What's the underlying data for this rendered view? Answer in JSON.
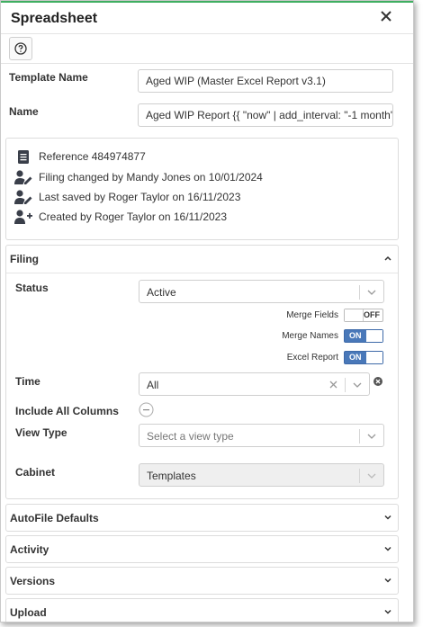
{
  "header": {
    "title": "Spreadsheet"
  },
  "form": {
    "template_name_label": "Template Name",
    "template_name_value": "Aged WIP (Master Excel Report v3.1)",
    "name_label": "Name",
    "name_value": "Aged WIP Report {{ \"now\" | add_interval: \"-1 month\"..."
  },
  "info": {
    "reference": "Reference 484974877",
    "filing_changed": "Filing changed by Mandy Jones on 10/01/2024",
    "last_saved": "Last saved by Roger Taylor on 16/11/2023",
    "created": "Created by Roger Taylor on 16/11/2023"
  },
  "filing": {
    "title": "Filing",
    "status_label": "Status",
    "status_value": "Active",
    "merge_fields_label": "Merge Fields",
    "merge_fields_state": "OFF",
    "merge_names_label": "Merge Names",
    "merge_names_state": "ON",
    "excel_report_label": "Excel Report",
    "excel_report_state": "ON",
    "time_label": "Time",
    "time_value": "All",
    "include_all_columns_label": "Include All Columns",
    "view_type_label": "View Type",
    "view_type_placeholder": "Select a view type",
    "cabinet_label": "Cabinet",
    "cabinet_value": "Templates"
  },
  "sections": {
    "autofile": "AutoFile Defaults",
    "activity": "Activity",
    "versions": "Versions",
    "upload": "Upload"
  },
  "colors": {
    "accent_green": "#3fae61",
    "toggle_on": "#4978b9"
  }
}
